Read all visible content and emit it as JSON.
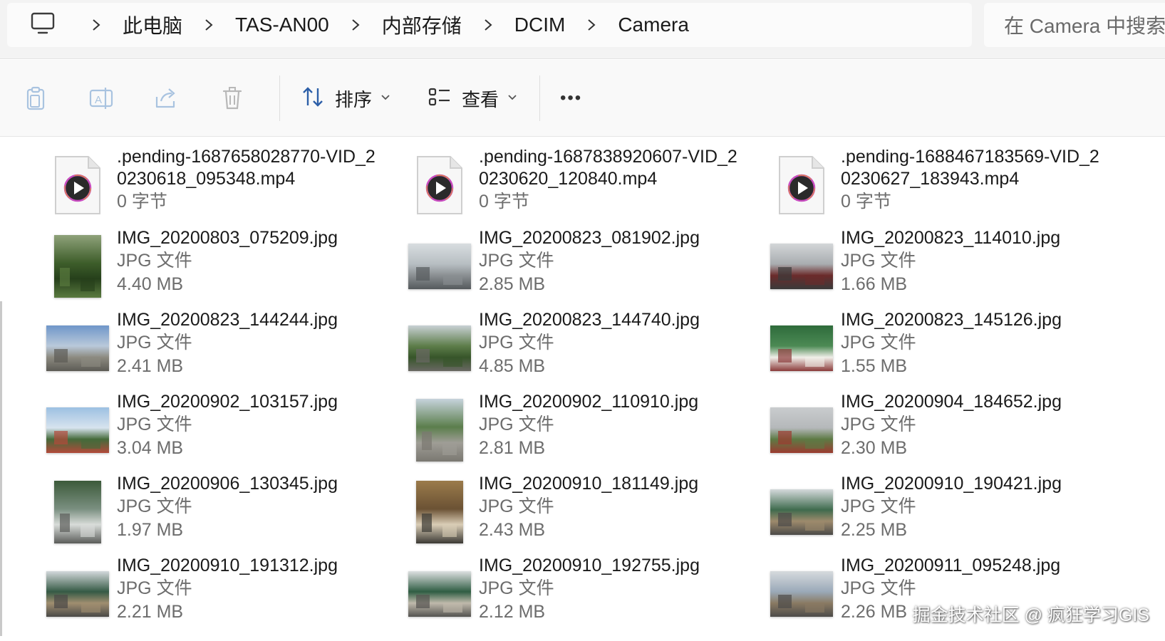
{
  "breadcrumb": {
    "items": [
      "此电脑",
      "TAS-AN00",
      "内部存储",
      "DCIM",
      "Camera"
    ]
  },
  "search": {
    "placeholder": "在 Camera 中搜索"
  },
  "toolbar": {
    "sort_label": "排序",
    "view_label": "查看",
    "more_label": "•••"
  },
  "files": [
    {
      "name": ".pending-1687658028770-VID_20230618_095348.mp4",
      "line1": ".pending-1687658028770-VID_2",
      "line2": "0230618_095348.mp4",
      "size": "0 字节",
      "kind": "video"
    },
    {
      "name": ".pending-1687838920607-VID_20230620_120840.mp4",
      "line1": ".pending-1687838920607-VID_2",
      "line2": "0230620_120840.mp4",
      "size": "0 字节",
      "kind": "video"
    },
    {
      "name": ".pending-1688467183569-VID_20230627_183943.mp4",
      "line1": ".pending-1688467183569-VID_2",
      "line2": "0230627_183943.mp4",
      "size": "0 字节",
      "kind": "video"
    },
    {
      "name": "IMG_20200803_075209.jpg",
      "type": "JPG 文件",
      "size": "4.40 MB",
      "kind": "photo",
      "orient": "portrait",
      "palette": [
        "#8fa27a",
        "#3d5d2a",
        "#26401b",
        "#5a7a3f"
      ]
    },
    {
      "name": "IMG_20200823_081902.jpg",
      "type": "JPG 文件",
      "size": "2.85 MB",
      "kind": "photo",
      "orient": "landscape",
      "palette": [
        "#d8dde0",
        "#b7bec2",
        "#8a8f92",
        "#555a5d"
      ]
    },
    {
      "name": "IMG_20200823_114010.jpg",
      "type": "JPG 文件",
      "size": "1.66 MB",
      "kind": "photo",
      "orient": "landscape",
      "palette": [
        "#d3d6d8",
        "#a9adb0",
        "#6b2b2b",
        "#3a3a3a"
      ]
    },
    {
      "name": "IMG_20200823_144244.jpg",
      "type": "JPG 文件",
      "size": "2.41 MB",
      "kind": "photo",
      "orient": "landscape",
      "palette": [
        "#6f96c9",
        "#b9c9da",
        "#8c8a80",
        "#5c5b55"
      ]
    },
    {
      "name": "IMG_20200823_144740.jpg",
      "type": "JPG 文件",
      "size": "4.85 MB",
      "kind": "photo",
      "orient": "landscape",
      "palette": [
        "#c8d0d4",
        "#5d7d4a",
        "#37552a",
        "#6a6864"
      ]
    },
    {
      "name": "IMG_20200823_145126.jpg",
      "type": "JPG 文件",
      "size": "1.55 MB",
      "kind": "photo",
      "orient": "landscape",
      "palette": [
        "#2e6b3b",
        "#4c8a54",
        "#f0eee8",
        "#8b3b3b"
      ]
    },
    {
      "name": "IMG_20200902_103157.jpg",
      "type": "JPG 文件",
      "size": "3.04 MB",
      "kind": "photo",
      "orient": "landscape",
      "palette": [
        "#9cc0e2",
        "#d7e3ee",
        "#456a3a",
        "#b34a3a"
      ]
    },
    {
      "name": "IMG_20200902_110910.jpg",
      "type": "JPG 文件",
      "size": "2.81 MB",
      "kind": "photo",
      "orient": "portrait",
      "palette": [
        "#c6d3dc",
        "#5b7e4c",
        "#9f9d96",
        "#7a7871"
      ]
    },
    {
      "name": "IMG_20200904_184652.jpg",
      "type": "JPG 文件",
      "size": "2.30 MB",
      "kind": "photo",
      "orient": "landscape",
      "palette": [
        "#c9ccce",
        "#b5b8ba",
        "#5d7a44",
        "#9c3b30"
      ]
    },
    {
      "name": "IMG_20200906_130345.jpg",
      "type": "JPG 文件",
      "size": "1.97 MB",
      "kind": "photo",
      "orient": "portrait",
      "palette": [
        "#3c5a3a",
        "#7a8f80",
        "#d8dcd9",
        "#5b5d5a"
      ]
    },
    {
      "name": "IMG_20200910_181149.jpg",
      "type": "JPG 文件",
      "size": "2.43 MB",
      "kind": "photo",
      "orient": "portrait",
      "palette": [
        "#9b7b4b",
        "#6b5234",
        "#d9cdb6",
        "#3c3a35"
      ]
    },
    {
      "name": "IMG_20200910_190421.jpg",
      "type": "JPG 文件",
      "size": "2.25 MB",
      "kind": "photo",
      "orient": "landscape",
      "palette": [
        "#d5dadc",
        "#3f6b4e",
        "#9d8a6c",
        "#4b4a48"
      ]
    },
    {
      "name": "IMG_20200910_191312.jpg",
      "type": "JPG 文件",
      "size": "2.21 MB",
      "kind": "photo",
      "orient": "landscape",
      "palette": [
        "#d3d8db",
        "#355a45",
        "#a08e70",
        "#4a4947"
      ]
    },
    {
      "name": "IMG_20200910_192755.jpg",
      "type": "JPG 文件",
      "size": "2.12 MB",
      "kind": "photo",
      "orient": "landscape",
      "palette": [
        "#dde0e1",
        "#2f5d43",
        "#bfb9ab",
        "#545350"
      ]
    },
    {
      "name": "IMG_20200911_095248.jpg",
      "type": "JPG 文件",
      "size": "2.26 MB",
      "kind": "photo",
      "orient": "landscape",
      "palette": [
        "#d6dadd",
        "#9aa9b8",
        "#8a7a63",
        "#4d4c4a"
      ]
    }
  ],
  "watermark": "掘金技术社区 @ 疯狂学习GIS"
}
